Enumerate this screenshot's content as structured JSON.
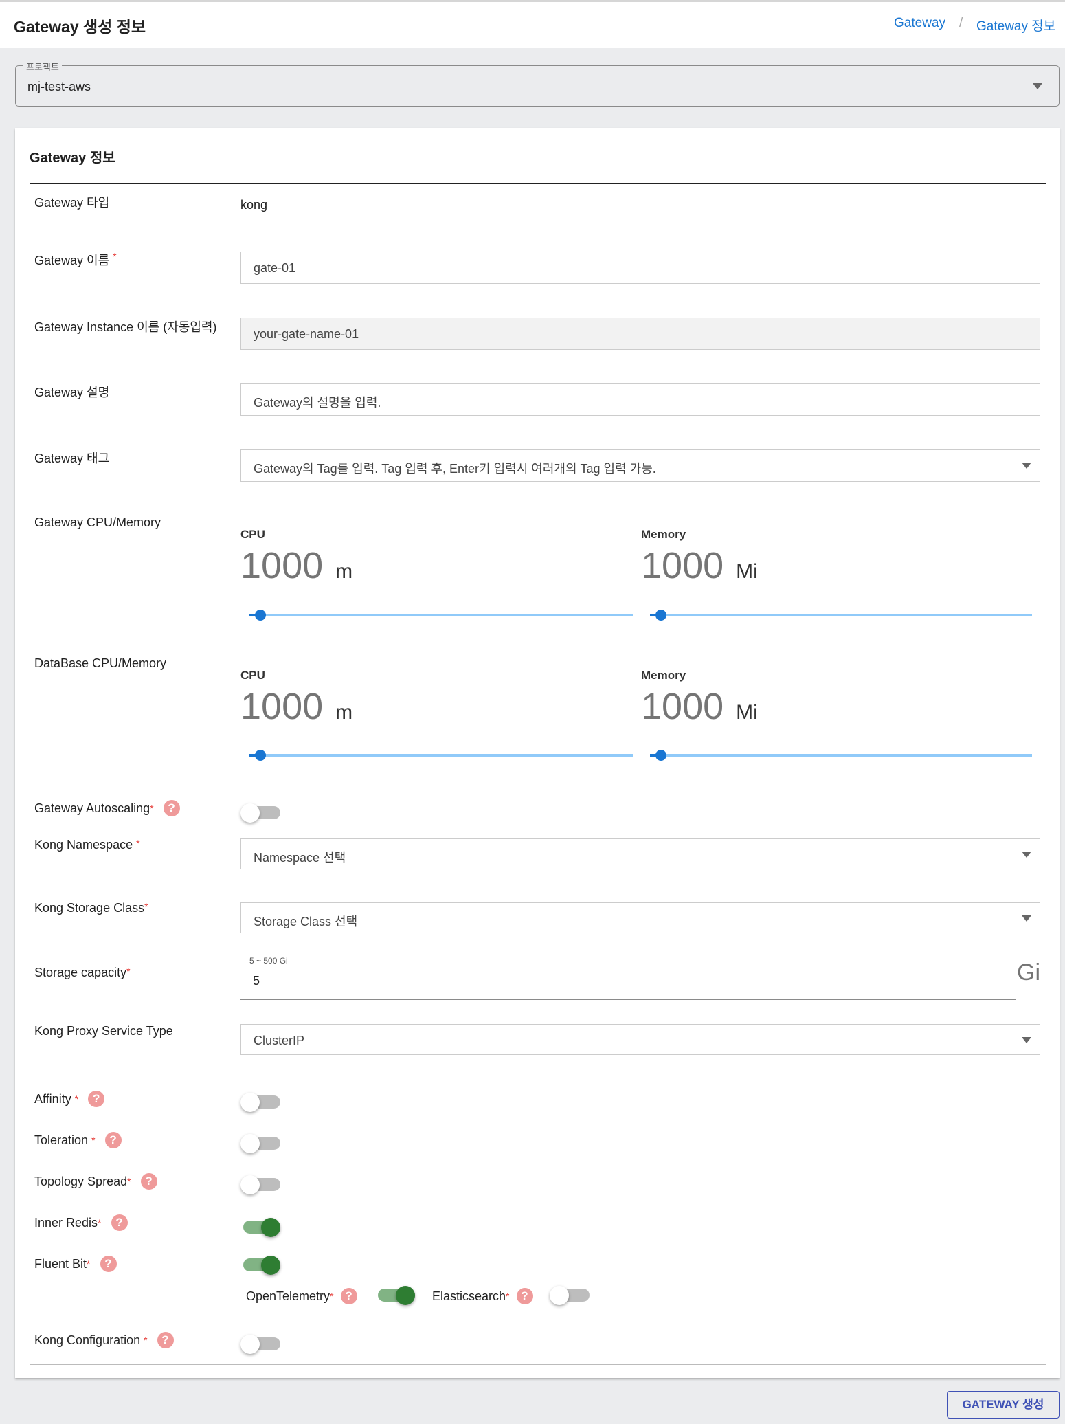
{
  "header": {
    "title": "Gateway 생성 정보",
    "breadcrumb": [
      "Gateway",
      "Gateway 정보"
    ],
    "separator": "/"
  },
  "project": {
    "label": "프로젝트",
    "value": "mj-test-aws"
  },
  "card": {
    "title": "Gateway 정보"
  },
  "fields": {
    "type": {
      "label": "Gateway 타입",
      "value": "kong"
    },
    "name": {
      "label": "Gateway 이름",
      "required": "*",
      "value": "gate-01"
    },
    "instance": {
      "label": "Gateway Instance 이름 (자동입력)",
      "value": "your-gate-name-01"
    },
    "description": {
      "label": "Gateway 설명",
      "placeholder": "Gateway의 설명을 입력."
    },
    "tags": {
      "label": "Gateway 태그",
      "placeholder": "Gateway의 Tag를 입력. Tag 입력 후, Enter키 입력시 여러개의 Tag 입력 가능."
    },
    "gw_resources": {
      "label": "Gateway CPU/Memory",
      "cpu_label": "CPU",
      "cpu_value": "1000",
      "cpu_unit": "m",
      "mem_label": "Memory",
      "mem_value": "1000",
      "mem_unit": "Mi"
    },
    "db_resources": {
      "label": "DataBase CPU/Memory",
      "cpu_label": "CPU",
      "cpu_value": "1000",
      "cpu_unit": "m",
      "mem_label": "Memory",
      "mem_value": "1000",
      "mem_unit": "Mi"
    },
    "autoscaling": {
      "label": "Gateway Autoscaling",
      "required": "*",
      "enabled": false
    },
    "namespace": {
      "label": "Kong Namespace",
      "required": "*",
      "value": "Namespace 선택"
    },
    "storage_class": {
      "label": "Kong Storage Class",
      "required": "*",
      "value": "Storage Class 선택"
    },
    "storage_capacity": {
      "label": "Storage capacity",
      "required": "*",
      "helper": "5 ~ 500 Gi",
      "value": "5",
      "unit": "Gi"
    },
    "proxy_type": {
      "label": "Kong Proxy Service Type",
      "value": "ClusterIP"
    },
    "affinity": {
      "label": "Affinity",
      "required": "*",
      "enabled": false
    },
    "toleration": {
      "label": "Toleration",
      "required": "*",
      "enabled": false
    },
    "topology": {
      "label": "Topology Spread",
      "required": "*",
      "enabled": false
    },
    "inner_redis": {
      "label": "Inner Redis",
      "required": "*",
      "enabled": true
    },
    "fluent_bit": {
      "label": "Fluent Bit",
      "required": "*",
      "enabled": true
    },
    "opentelemetry": {
      "label": "OpenTelemetry",
      "required": "*",
      "enabled": true
    },
    "elasticsearch": {
      "label": "Elasticsearch",
      "required": "*",
      "enabled": false
    },
    "kong_config": {
      "label": "Kong Configuration",
      "required": "*",
      "enabled": false
    }
  },
  "help_glyph": "?",
  "actions": {
    "create_label": "GATEWAY 생성"
  },
  "colors": {
    "accent": "#1976d2",
    "toggle_on": "#2e7d32",
    "help": "#ef9a9a",
    "button": "#3f51b5"
  }
}
